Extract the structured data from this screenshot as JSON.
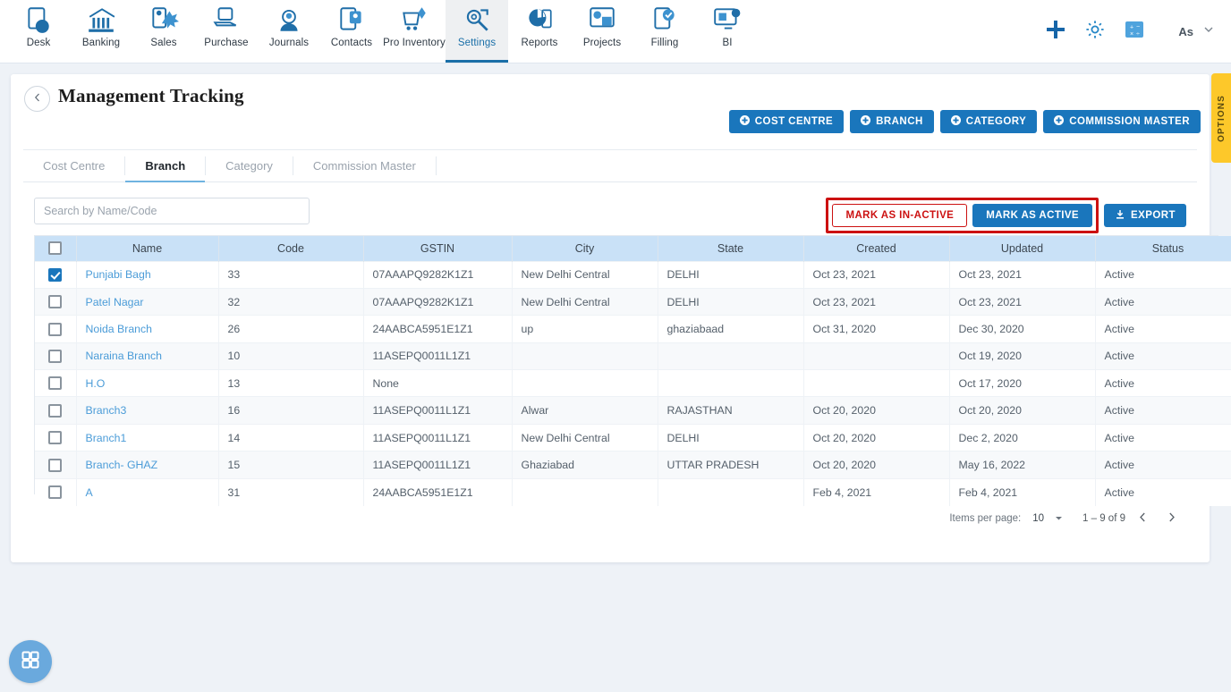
{
  "topnav": {
    "items": [
      {
        "label": "Desk",
        "icon": "desk-icon"
      },
      {
        "label": "Banking",
        "icon": "banking-icon"
      },
      {
        "label": "Sales",
        "icon": "sales-icon"
      },
      {
        "label": "Purchase",
        "icon": "purchase-icon"
      },
      {
        "label": "Journals",
        "icon": "journals-icon"
      },
      {
        "label": "Contacts",
        "icon": "contacts-icon"
      },
      {
        "label": "Pro Inventory",
        "icon": "pro-inventory-icon"
      },
      {
        "label": "Settings",
        "icon": "settings-icon"
      },
      {
        "label": "Reports",
        "icon": "reports-icon"
      },
      {
        "label": "Projects",
        "icon": "projects-icon"
      },
      {
        "label": "Filling",
        "icon": "filling-icon"
      },
      {
        "label": "BI",
        "icon": "bi-icon"
      }
    ],
    "active_index": 7,
    "right": {
      "add_icon": "plus-icon",
      "settings_icon": "gear-icon",
      "calculator_icon": "calculator-icon",
      "user_label": "As",
      "user_caret_icon": "chevron-down-icon"
    }
  },
  "page": {
    "title": "Management Tracking",
    "back_icon": "chevron-left-icon"
  },
  "top_buttons": [
    {
      "label": "COST CENTRE",
      "icon": "plus-circle-icon"
    },
    {
      "label": "BRANCH",
      "icon": "plus-circle-icon"
    },
    {
      "label": "CATEGORY",
      "icon": "plus-circle-icon"
    },
    {
      "label": "COMMISSION MASTER",
      "icon": "plus-circle-icon"
    }
  ],
  "tabs": [
    {
      "label": "Cost Centre",
      "active": false
    },
    {
      "label": "Branch",
      "active": true
    },
    {
      "label": "Category",
      "active": false
    },
    {
      "label": "Commission Master",
      "active": false
    }
  ],
  "search": {
    "placeholder": "Search by Name/Code",
    "value": ""
  },
  "actions": {
    "mark_inactive_label": "MARK AS IN-ACTIVE",
    "mark_active_label": "MARK AS ACTIVE",
    "export_label": "EXPORT",
    "export_icon": "download-icon",
    "highlight_color": "#cc1111",
    "accent_color": "#1a76bc"
  },
  "table": {
    "columns": [
      "Name",
      "Code",
      "GSTIN",
      "City",
      "State",
      "Created",
      "Updated",
      "Status"
    ],
    "header_checkbox_checked": false,
    "rows": [
      {
        "checked": true,
        "name": "Punjabi Bagh",
        "code": "33",
        "gstin": "07AAAPQ9282K1Z1",
        "city": "New Delhi Central",
        "state": "DELHI",
        "created": "Oct 23, 2021",
        "updated": "Oct 23, 2021",
        "status": "Active"
      },
      {
        "checked": false,
        "name": "Patel Nagar",
        "code": "32",
        "gstin": "07AAAPQ9282K1Z1",
        "city": "New Delhi Central",
        "state": "DELHI",
        "created": "Oct 23, 2021",
        "updated": "Oct 23, 2021",
        "status": "Active"
      },
      {
        "checked": false,
        "name": "Noida Branch",
        "code": "26",
        "gstin": "24AABCA5951E1Z1",
        "city": "up",
        "state": "ghaziabaad",
        "created": "Oct 31, 2020",
        "updated": "Dec 30, 2020",
        "status": "Active"
      },
      {
        "checked": false,
        "name": "Naraina Branch",
        "code": "10",
        "gstin": "11ASEPQ0011L1Z1",
        "city": "",
        "state": "",
        "created": "",
        "updated": "Oct 19, 2020",
        "status": "Active"
      },
      {
        "checked": false,
        "name": "H.O",
        "code": "13",
        "gstin": "None",
        "city": "",
        "state": "",
        "created": "",
        "updated": "Oct 17, 2020",
        "status": "Active"
      },
      {
        "checked": false,
        "name": "Branch3",
        "code": "16",
        "gstin": "11ASEPQ0011L1Z1",
        "city": "Alwar",
        "state": "RAJASTHAN",
        "created": "Oct 20, 2020",
        "updated": "Oct 20, 2020",
        "status": "Active"
      },
      {
        "checked": false,
        "name": "Branch1",
        "code": "14",
        "gstin": "11ASEPQ0011L1Z1",
        "city": "New Delhi Central",
        "state": "DELHI",
        "created": "Oct 20, 2020",
        "updated": "Dec 2, 2020",
        "status": "Active"
      },
      {
        "checked": false,
        "name": "Branch- GHAZ",
        "code": "15",
        "gstin": "11ASEPQ0011L1Z1",
        "city": "Ghaziabad",
        "state": "UTTAR PRADESH",
        "created": "Oct 20, 2020",
        "updated": "May 16, 2022",
        "status": "Active"
      },
      {
        "checked": false,
        "name": "A",
        "code": "31",
        "gstin": "24AABCA5951E1Z1",
        "city": "",
        "state": "",
        "created": "Feb 4, 2021",
        "updated": "Feb 4, 2021",
        "status": "Active"
      }
    ]
  },
  "paginator": {
    "items_per_page_label": "Items per page:",
    "items_per_page_value": "10",
    "range_label": "1 – 9 of 9",
    "prev_icon": "chevron-left-icon",
    "next_icon": "chevron-right-icon"
  },
  "options_tab": {
    "label": "OPTIONS",
    "color": "#fdc82a"
  },
  "fab": {
    "icon": "grid-apps-icon"
  }
}
